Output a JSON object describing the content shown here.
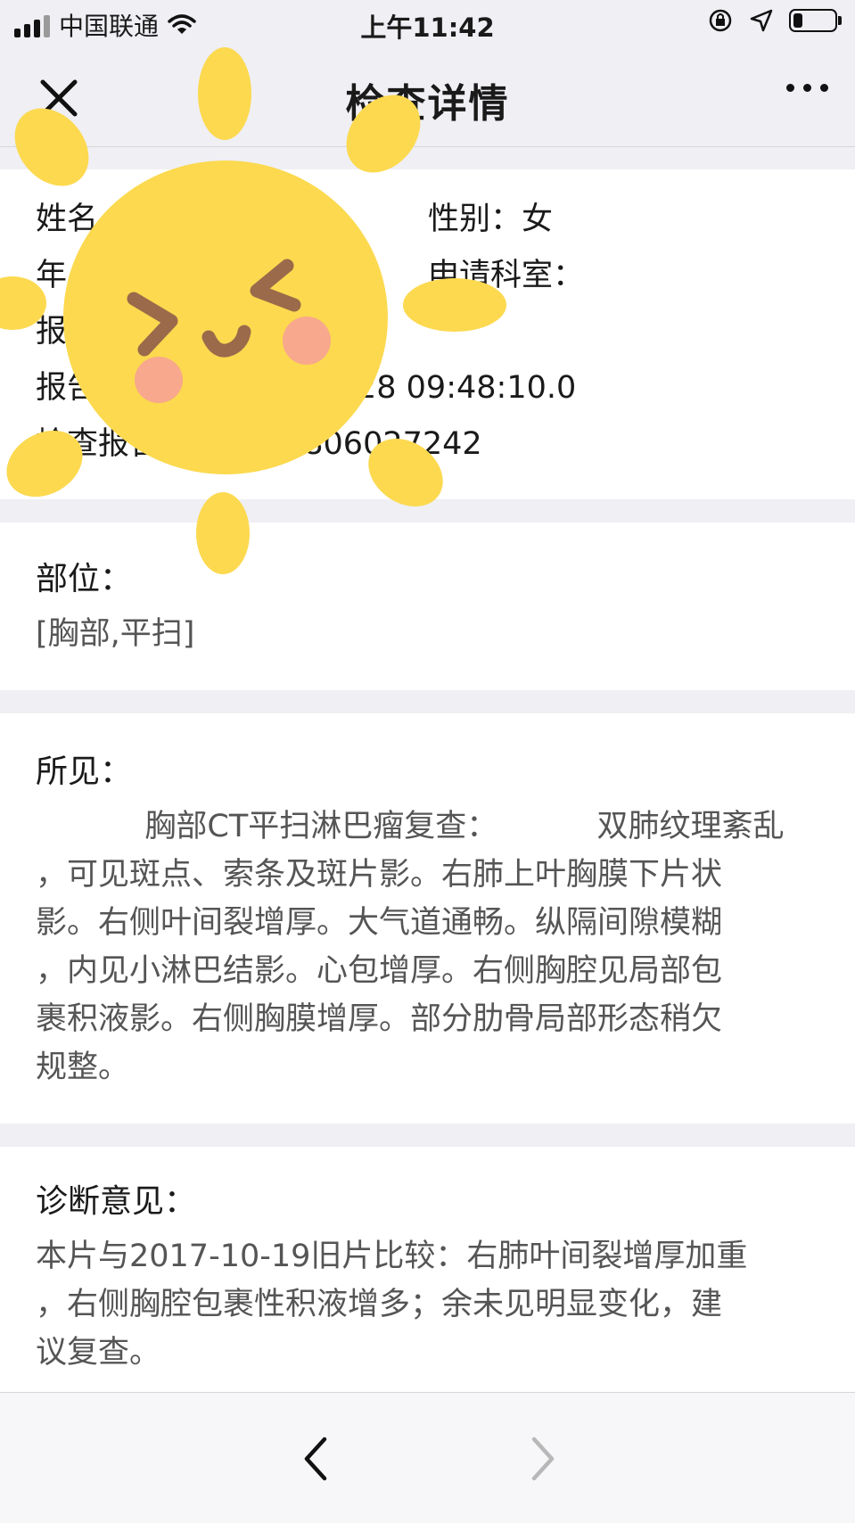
{
  "status_bar": {
    "carrier": "中国联通",
    "time": "上午11:42",
    "battery_level": 0.25
  },
  "nav": {
    "title": "检查详情"
  },
  "patient": {
    "name_label": "姓名",
    "gender_label": "性别：",
    "gender_value": "女",
    "age_label": "年",
    "dept_label": "申请科室：",
    "report_label_1": "报",
    "report_time_label": "报告",
    "report_time_value": "28 09:48:10.0",
    "report_no_label": "检查报告",
    "report_no_value": "1806027242"
  },
  "site": {
    "title": "部位：",
    "value": "[胸部,平扫]"
  },
  "findings": {
    "title": "所见：",
    "body": "           胸部CT平扫淋巴瘤复查：          双肺纹理紊乱\n，可见斑点、索条及斑片影。右肺上叶胸膜下片状\n影。右侧叶间裂增厚。大气道通畅。纵隔间隙模糊\n，内见小淋巴结影。心包增厚。右侧胸腔见局部包\n裹积液影。右侧胸膜增厚。部分肋骨局部形态稍欠\n规整。"
  },
  "diagnosis": {
    "title": "诊断意见：",
    "body": "本片与2017-10-19旧片比较：右肺叶间裂增厚加重\n，右侧胸腔包裹性积液增多；余未见明显变化，建\n议复查。"
  },
  "colors": {
    "background": "#efeff4",
    "card": "#ffffff",
    "sticker_yellow": "#fcd94f",
    "sticker_blush": "#f8a88c",
    "sticker_features": "#9a6a4a"
  },
  "icons": {
    "close": "close-icon",
    "more": "more-icon",
    "back": "chevron-left-icon",
    "forward": "chevron-right-icon"
  }
}
